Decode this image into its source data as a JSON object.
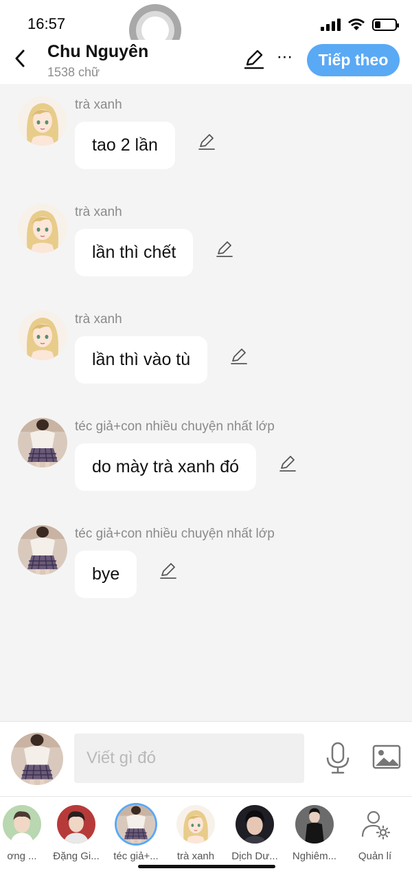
{
  "status_bar": {
    "time": "16:57",
    "signal_icon": "signal-icon",
    "wifi_icon": "wifi-icon",
    "battery_icon": "battery-icon",
    "battery_level": 0.3
  },
  "header": {
    "back_icon": "chevron-left-icon",
    "title": "Chu Nguyên",
    "subtitle": "1538 chữ",
    "edit_icon": "pencil-icon",
    "more_label": "···",
    "next_label": "Tiếp theo",
    "accent_color": "#5aa9f5"
  },
  "messages": [
    {
      "sender": "téc giả+con nhiều chuyện nhất lớp",
      "avatar": "girl-plaid-skirt",
      "text": "bye"
    },
    {
      "sender": "trà xanh",
      "avatar": "blonde-anime-girl",
      "text": "tao 2 lần"
    },
    {
      "sender": "trà xanh",
      "avatar": "blonde-anime-girl",
      "text": "lần thì chết"
    },
    {
      "sender": "trà xanh",
      "avatar": "blonde-anime-girl",
      "text": "lần thì vào tù"
    },
    {
      "sender": "téc giả+con nhiều chuyện nhất lớp",
      "avatar": "girl-plaid-skirt",
      "text": "do mày trà xanh đó"
    },
    {
      "sender": "téc giả+con nhiều chuyện nhất lớp",
      "avatar": "girl-plaid-skirt",
      "text": "bye"
    }
  ],
  "input_bar": {
    "placeholder": "Viết gì đó",
    "mic_icon": "microphone-icon",
    "image_icon": "image-icon"
  },
  "characters": [
    {
      "name": "ơng ...",
      "avatar": "boy-portrait"
    },
    {
      "name": "Đặng Gi...",
      "avatar": "boy-red-bg"
    },
    {
      "name": "téc giả+...",
      "avatar": "girl-plaid-skirt",
      "selected": true
    },
    {
      "name": "trà xanh",
      "avatar": "blonde-anime-girl"
    },
    {
      "name": "Dịch Dư...",
      "avatar": "boy-dark-hair"
    },
    {
      "name": "Nghiêm...",
      "avatar": "boy-black-outfit"
    }
  ],
  "manage": {
    "label": "Quản lí",
    "icon": "user-settings-icon"
  }
}
